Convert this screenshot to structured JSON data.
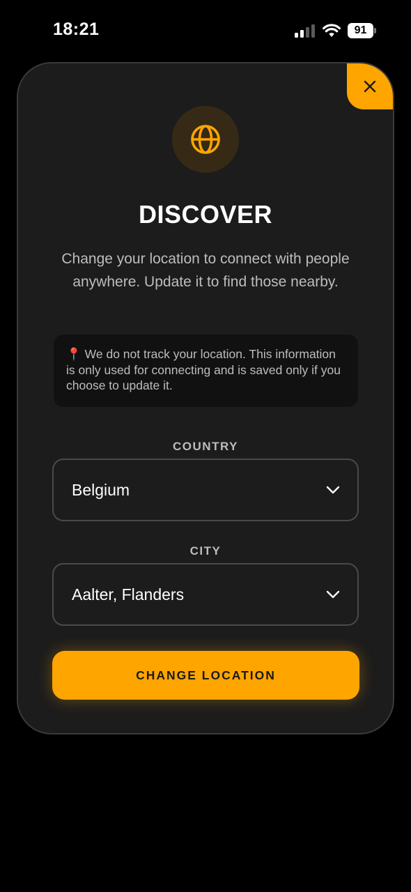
{
  "status_bar": {
    "time": "18:21",
    "battery": "91",
    "icons": [
      "signal-icon",
      "wifi-icon",
      "battery-icon"
    ]
  },
  "modal": {
    "close_icon": "close-icon",
    "header_icon": "globe-icon",
    "title": "DISCOVER",
    "description": "Change your location to connect with people anywhere. Update it to find those nearby.",
    "notice": {
      "icon": "📍",
      "text": "We do not track your location. This information is only used for connecting and is saved only if you choose to update it."
    },
    "country": {
      "label": "COUNTRY",
      "value": "Belgium"
    },
    "city": {
      "label": "CITY",
      "value": "Aalter, Flanders"
    },
    "submit_label": "CHANGE LOCATION"
  },
  "colors": {
    "accent": "#ffa500",
    "background": "#000000",
    "card": "#1c1c1c",
    "notice_bg": "#111111"
  }
}
